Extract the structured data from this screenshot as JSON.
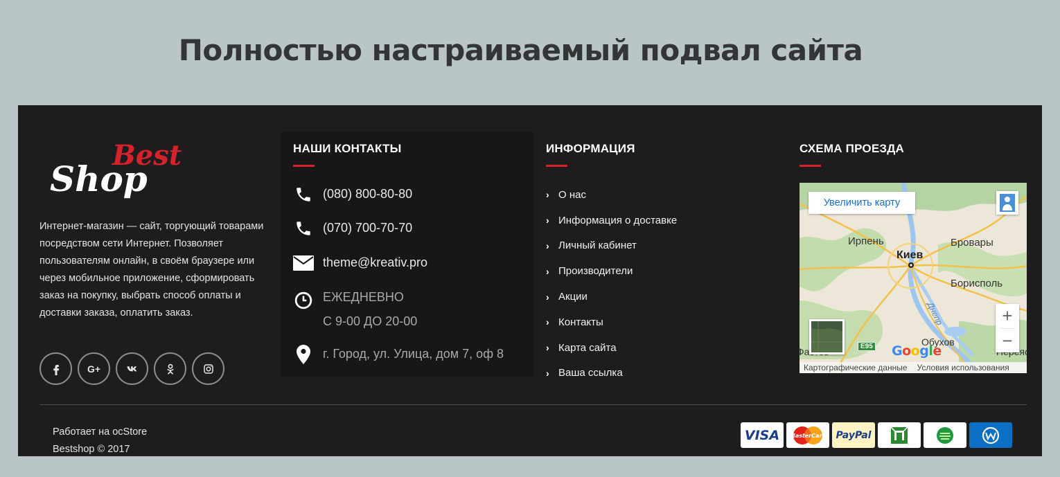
{
  "page": {
    "title": "Полностью настраиваемый подвал сайта"
  },
  "brand": {
    "logo_top": "Best",
    "logo_bottom": "Shop",
    "accent_color": "#d5232b"
  },
  "about": {
    "text": "Интернет-магазин — сайт, торгующий товарами посредством сети Интернет. Позволяет пользователям онлайн, в своём браузере или через мобильное приложение, сформировать заказ на покупку, выбрать способ оплаты и доставки заказа, оплатить заказ."
  },
  "socials": [
    {
      "name": "facebook",
      "label": "f"
    },
    {
      "name": "google-plus",
      "label": "G+"
    },
    {
      "name": "vk",
      "label": "vk"
    },
    {
      "name": "odnoklassniki",
      "label": "ok"
    },
    {
      "name": "instagram",
      "label": "ig"
    }
  ],
  "contacts": {
    "title": "НАШИ КОНТАКТЫ",
    "phone1": "(080) 800-80-80",
    "phone2": "(070) 700-70-70",
    "email": "theme@kreativ.pro",
    "hours_line1": "ЕЖЕДНЕВНО",
    "hours_line2": "С 9-00 ДО 20-00",
    "address": "г. Город, ул. Улица, дом 7, оф 8"
  },
  "info": {
    "title": "ИНФОРМАЦИЯ",
    "items": [
      "О нас",
      "Информация о доставке",
      "Личный кабинет",
      "Производители",
      "Акции",
      "Контакты",
      "Карта сайта",
      "Ваша ссылка"
    ]
  },
  "map": {
    "title": "СХЕМА ПРОЕЗДА",
    "enlarge_label": "Увеличить карту",
    "labels": {
      "irpen": "Ирпень",
      "brovary": "Бровары",
      "kiev": "Киев",
      "boryspil": "Борисполь",
      "dnipro": "Днепр",
      "obukhov": "Обухов",
      "fastov": "Фастов",
      "pereyaslav": "Переяс",
      "e95": "E95"
    },
    "zoom_in": "+",
    "zoom_out": "−",
    "google": "Google",
    "footer_data": "Картографические данные",
    "footer_terms": "Условия использования"
  },
  "bottom": {
    "powered_prefix": "Работает на ",
    "powered_link": "ocStore",
    "copyright": "Bestshop © 2017"
  },
  "payments": [
    {
      "name": "visa",
      "label": "VISA"
    },
    {
      "name": "mastercard",
      "label": "MasterCard"
    },
    {
      "name": "paypal",
      "label": "PayPal"
    },
    {
      "name": "privatbank",
      "label": ""
    },
    {
      "name": "sberbank",
      "label": ""
    },
    {
      "name": "webmoney",
      "label": ""
    }
  ]
}
